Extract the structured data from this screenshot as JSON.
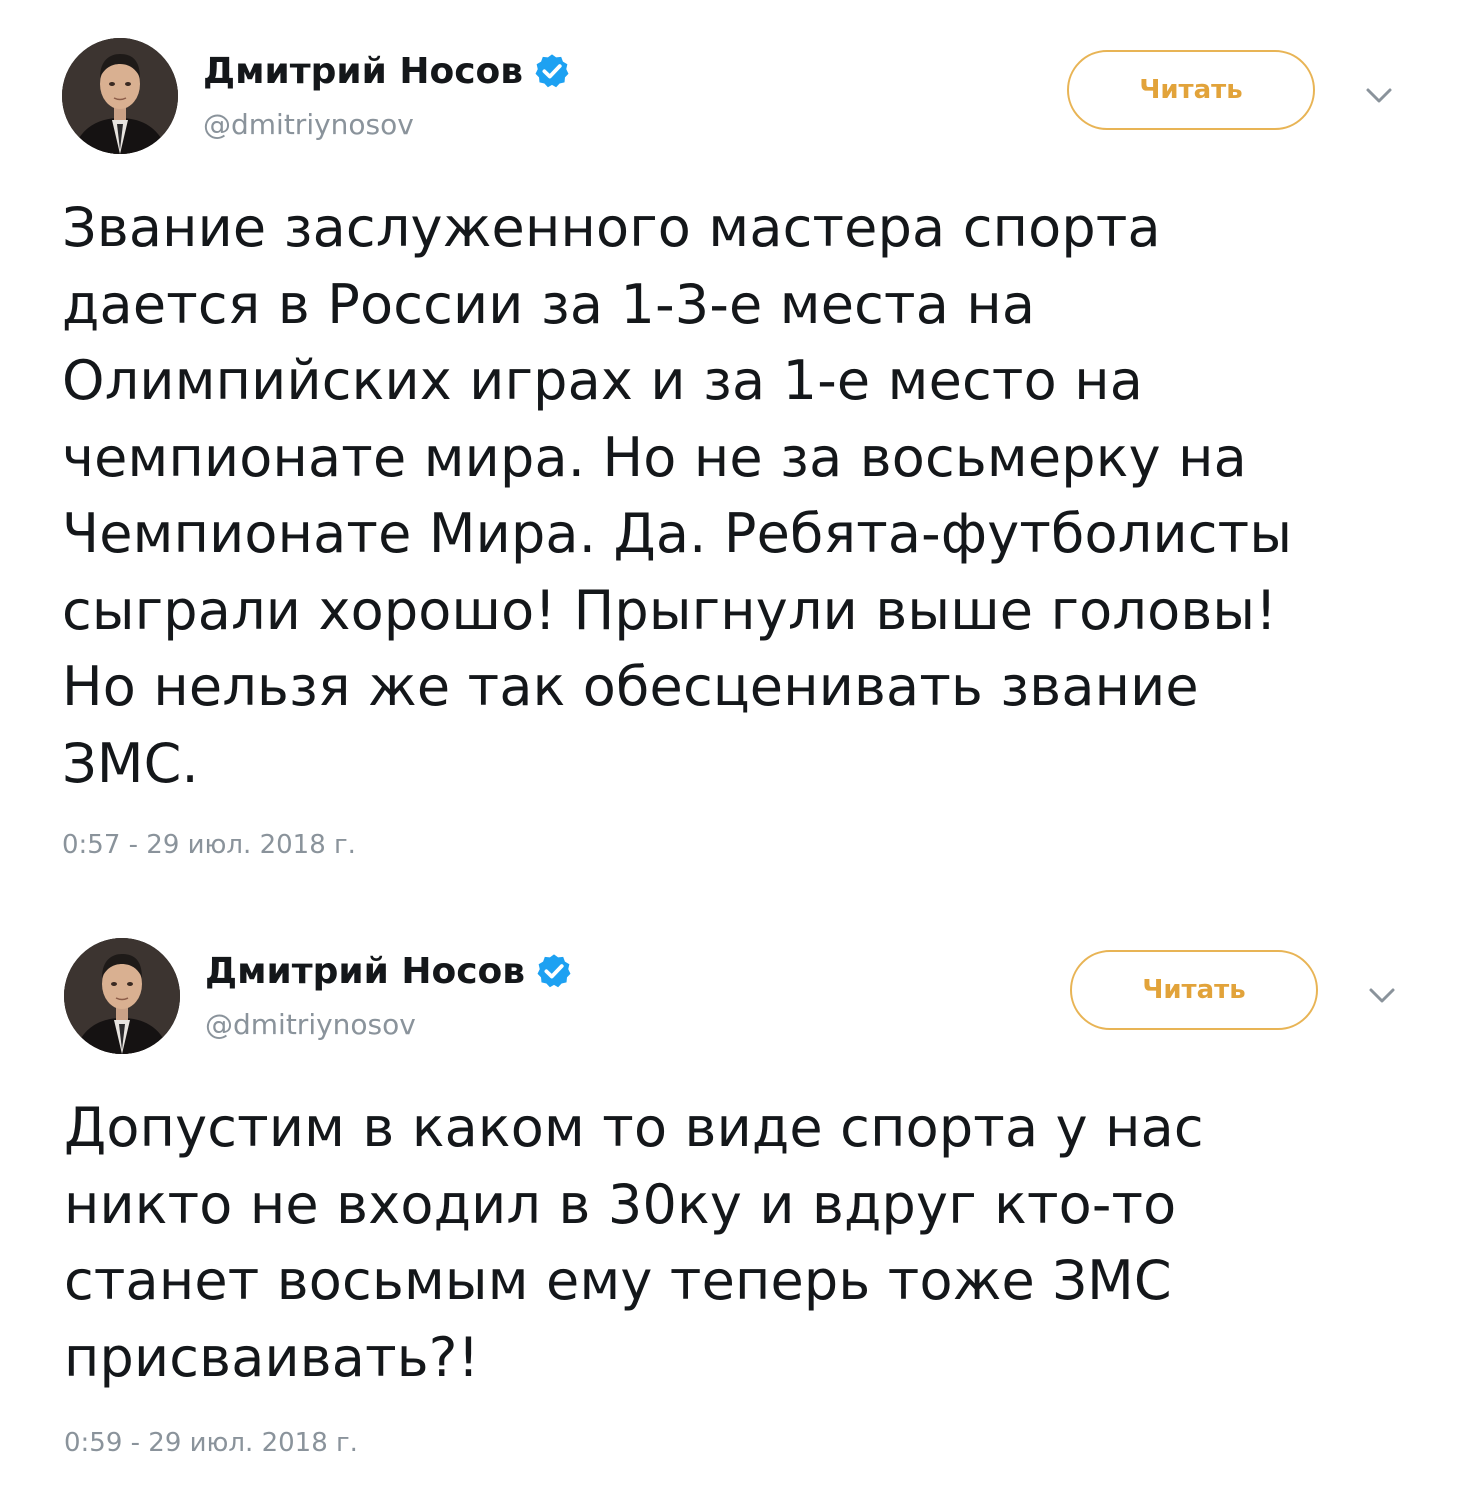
{
  "tweets": [
    {
      "author": {
        "display_name": "Дмитрий Носов",
        "handle": "@dmitriynosov",
        "verified": true
      },
      "follow_label": "Читать",
      "text": "Звание заслуженного мастера спорта\nдается в России за 1-3-е места на\nОлимпийских играх и за 1-е место на\nчемпионате мира. Но не за восьмерку на\nЧемпионате Мира. Да. Ребята-футболисты\nсыграли хорошо! Прыгнули выше головы!\nНо нельзя же так обесценивать звание\nЗМС.",
      "timestamp": "0:57 - 29 июл. 2018 г."
    },
    {
      "author": {
        "display_name": "Дмитрий Носов",
        "handle": "@dmitriynosov",
        "verified": true
      },
      "follow_label": "Читать",
      "text": "Допустим в каком то виде спорта у нас\nникто не входил в 30ку и вдруг кто-то\nстанет восьмым ему теперь тоже ЗМС\nприсваивать?!",
      "timestamp": "0:59 - 29 июл. 2018 г."
    }
  ],
  "colors": {
    "verified_badge": "#1da1f2",
    "follow_accent": "#e2a33a",
    "secondary_text": "#8a939b",
    "primary_text": "#14171a"
  },
  "icons": {
    "verified": "verified-badge-icon",
    "more": "chevron-down-icon"
  }
}
